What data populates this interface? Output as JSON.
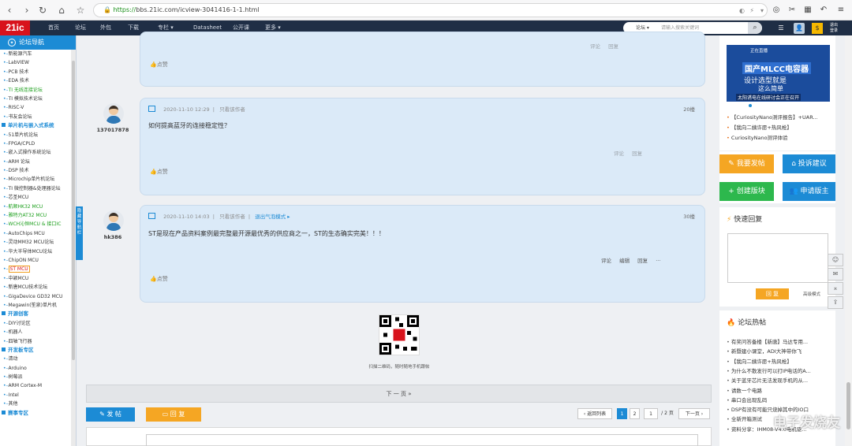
{
  "browser": {
    "url_scheme": "https://",
    "url_rest": "bbs.21ic.com/icview-3041416-1-1.html"
  },
  "topnav": {
    "logo": "21ic",
    "items": [
      "首页",
      "论坛",
      "外包",
      "下载",
      "专栏 ▾",
      "Datasheet",
      "公开课",
      "更多 ▾"
    ],
    "search_scope": "论坛 ▾",
    "search_placeholder": "请输入搜索关键词",
    "right_label": "退出 登录"
  },
  "sidebar": {
    "title": "论坛导航",
    "tab_label": "隐藏导航栏",
    "items": [
      {
        "t": "新能源汽车",
        "k": "ch"
      },
      {
        "t": "LabVIEW",
        "k": "ch"
      },
      {
        "t": "PCB 技术",
        "k": "ch"
      },
      {
        "t": "EDA 技术",
        "k": "ch"
      },
      {
        "t": "TI 无线连接论坛",
        "k": "ch green"
      },
      {
        "t": "TI 模拟技术论坛",
        "k": "ch"
      },
      {
        "t": "RISC-V",
        "k": "ch"
      },
      {
        "t": "书友会论坛",
        "k": "ch"
      },
      {
        "t": "单片机与嵌入式系统",
        "k": "cat"
      },
      {
        "t": "51单片机论坛",
        "k": "ch"
      },
      {
        "t": "FPGA/CPLD",
        "k": "ch"
      },
      {
        "t": "嵌入式操作系统论坛",
        "k": "ch"
      },
      {
        "t": "ARM 论坛",
        "k": "ch"
      },
      {
        "t": "DSP 技术",
        "k": "ch"
      },
      {
        "t": "Microchip单片机论坛",
        "k": "ch"
      },
      {
        "t": "TI 微控制器&处理器论坛",
        "k": "ch"
      },
      {
        "t": "芯圣MCU",
        "k": "ch"
      },
      {
        "t": "航顺HK32 MCU",
        "k": "ch green"
      },
      {
        "t": "雅特力AT32 MCU",
        "k": "ch green"
      },
      {
        "t": "WCH沁恒MCU & 接口IC",
        "k": "ch green"
      },
      {
        "t": "AutoChips MCU",
        "k": "ch"
      },
      {
        "t": "灵动MM32 MCU论坛",
        "k": "ch"
      },
      {
        "t": "华大半导体MCU论坛",
        "k": "ch"
      },
      {
        "t": "ChipON MCU",
        "k": "ch"
      },
      {
        "t": "ST MCU",
        "k": "ch hl"
      },
      {
        "t": "中颖MCU",
        "k": "ch"
      },
      {
        "t": "新唐MCU技术论坛",
        "k": "ch"
      },
      {
        "t": "GigaDevice GD32 MCU",
        "k": "ch"
      },
      {
        "t": "Megawin(笙泉)单片机",
        "k": "ch"
      },
      {
        "t": "开源创客",
        "k": "cat"
      },
      {
        "t": "DIY讨论区",
        "k": "ch"
      },
      {
        "t": "机器人",
        "k": "ch"
      },
      {
        "t": "四轴飞行器",
        "k": "ch"
      },
      {
        "t": "开发板专区",
        "k": "cat"
      },
      {
        "t": "清动",
        "k": "ch"
      },
      {
        "t": "Arduino",
        "k": "ch"
      },
      {
        "t": "树莓派",
        "k": "ch"
      },
      {
        "t": "ARM Cortex-M",
        "k": "ch"
      },
      {
        "t": "Intel",
        "k": "ch"
      },
      {
        "t": "其他",
        "k": "ch"
      },
      {
        "t": "赛事专区",
        "k": "cat"
      }
    ]
  },
  "posts": {
    "p0": {
      "actions": [
        "评论",
        "回复"
      ],
      "like": "点赞"
    },
    "p1": {
      "user": "137017878",
      "date": "2020-11-10 12:29",
      "only": "只看该作者",
      "floor": "20楼",
      "text": "如何提高蓝牙的连接稳定性？",
      "actions": [
        "评论",
        "回复"
      ],
      "like": "点赞"
    },
    "p2": {
      "user": "hk386",
      "date": "2020-11-10 14:03",
      "only": "只看该作者",
      "mode": "退出气泡模式 ▸",
      "floor": "30楼",
      "text": "ST是现在产品资料案例最完整最开源最优秀的供应商之一，ST的生态确实完美！！！",
      "actions": [
        "评论",
        "编辑",
        "回复"
      ],
      "like": "点赞"
    }
  },
  "qr": {
    "caption": "扫描二维码，随时随地手机跟帖"
  },
  "pager": {
    "next": "下 一 页  »"
  },
  "bottom": {
    "post_btn": "发 帖",
    "reply_btn": "回 复",
    "back": "‹ 返回列表",
    "pages": [
      "1",
      "2"
    ],
    "page_input": "1",
    "page_total": "/ 2 页",
    "next": "下一页 ›"
  },
  "right": {
    "ad": {
      "brand": "正在直播",
      "title": "国产MLCC电容器",
      "line": "设计选型就是",
      "line2": "这么简单",
      "foot": "太阳诱电在线研讨会正在召开"
    },
    "links": [
      "【CuriosityNano测评报告】+UAR...",
      "【我向二姨许愿+热风枪】",
      "CuriosityNano测评体验"
    ],
    "btn_post": "我要发帖",
    "btn_suggest": "投诉建议",
    "btn_create": "创建版块",
    "btn_mod": "申请版主",
    "quick_title": "快速回复",
    "quick_reply": "回 复",
    "adv": "高级模式",
    "hot_title": "论坛热帖",
    "hot": [
      "有奖问答备楼【新唐】马达专用...",
      "新暨建小课堂，ADI大神带你飞",
      "【我向二姨许愿+热风枪】",
      "为什么不散发行可以打IP电话的A...",
      "关于蓝牙芯片无法发现手机的从...",
      "请数一个电路",
      "串口会出现乱码",
      "DSP有没有可能只烧掉其中的IO口",
      "全新开箱测试",
      "资料分享：IHM08-V4.0电机驱..."
    ]
  },
  "watermark": "电子发烧友",
  "colors": {
    "accent": "#1c8bd5",
    "orange": "#f5a623",
    "green": "#2db84d",
    "brand": "#d8131c"
  }
}
